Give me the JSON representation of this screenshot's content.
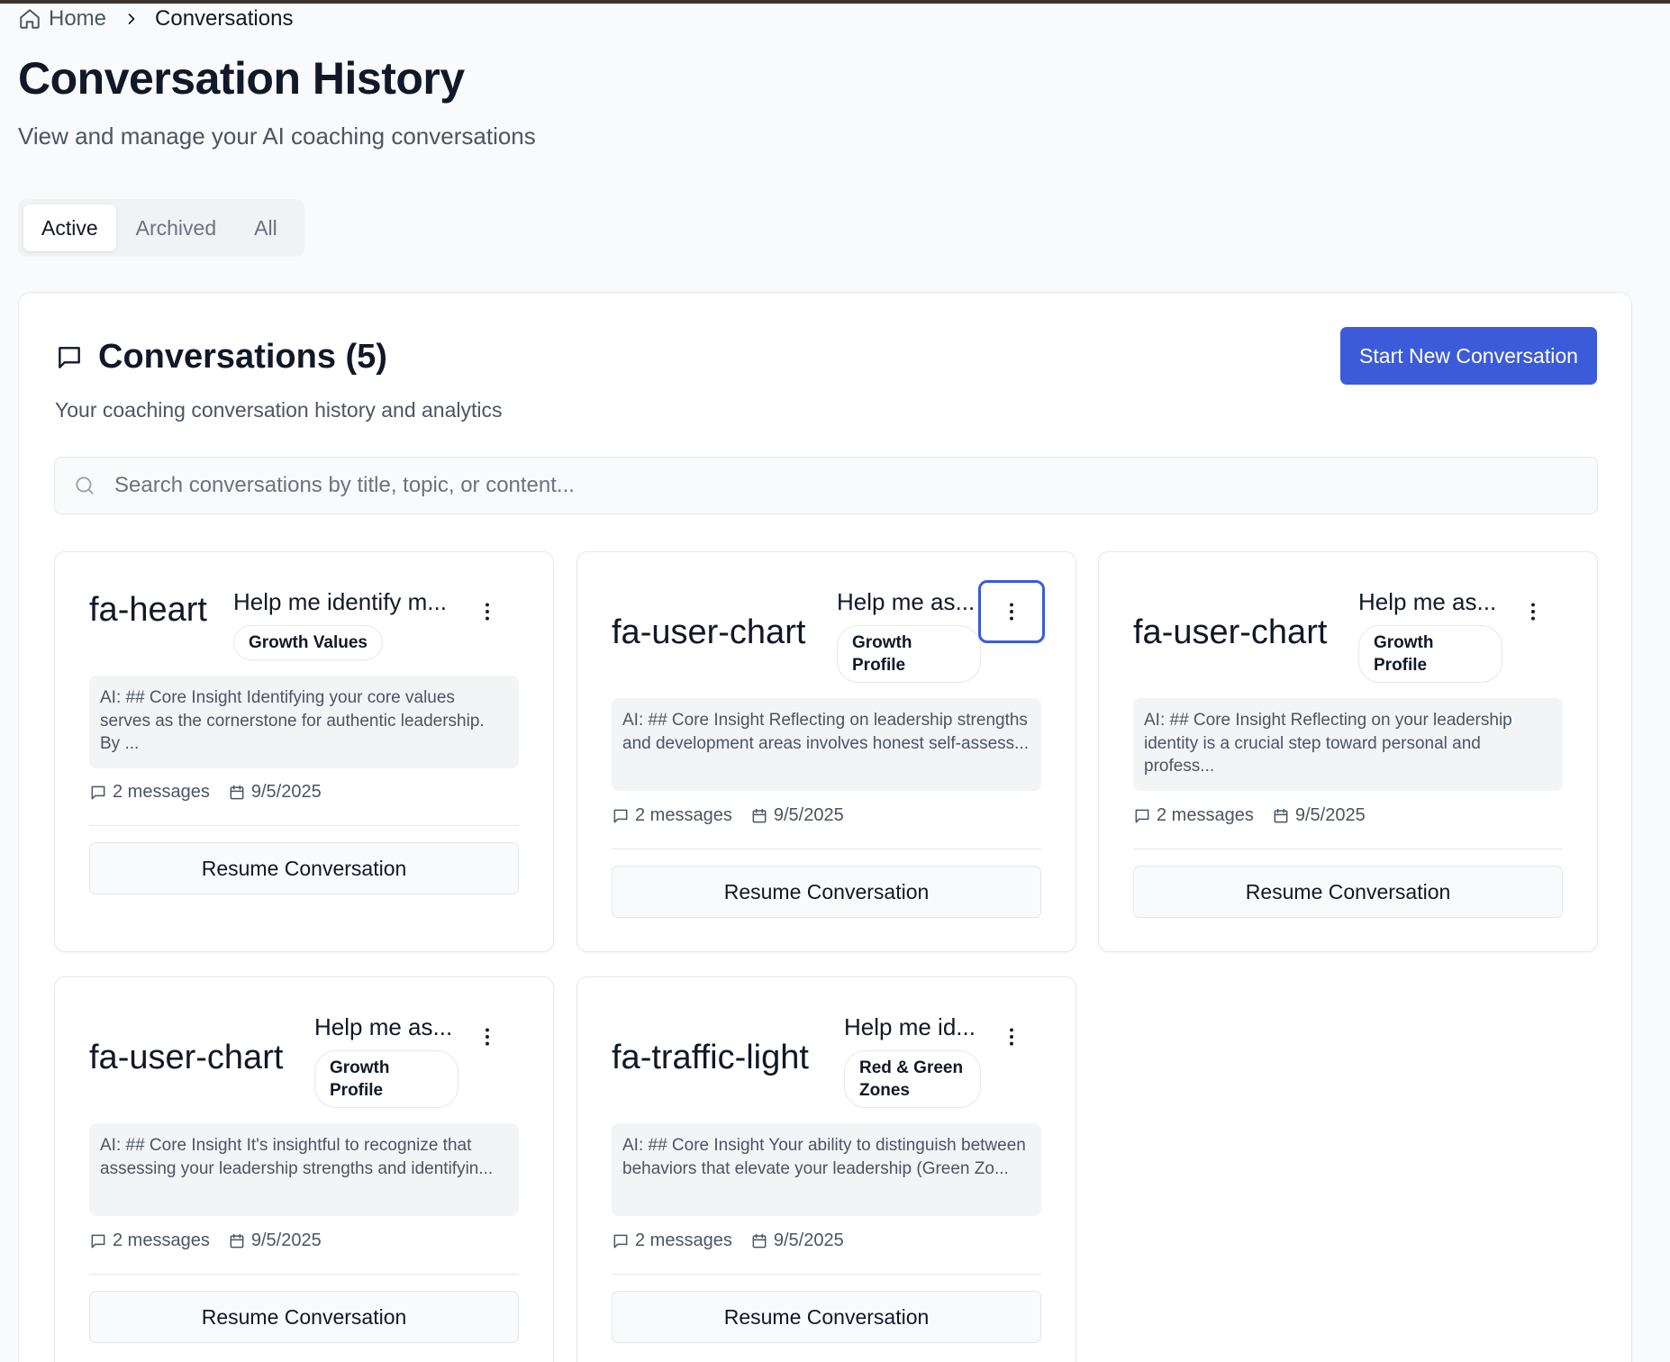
{
  "breadcrumb": {
    "home": "Home",
    "current": "Conversations"
  },
  "page": {
    "title": "Conversation History",
    "subtitle": "View and manage your AI coaching conversations"
  },
  "tabs": [
    {
      "label": "Active"
    },
    {
      "label": "Archived"
    },
    {
      "label": "All"
    }
  ],
  "panel": {
    "title": "Conversations (5)",
    "subtitle": "Your coaching conversation history and analytics",
    "new_button": "Start New Conversation"
  },
  "search": {
    "placeholder": "Search conversations by title, topic, or content..."
  },
  "colors": {
    "accent": "#3b5bdb",
    "text": "#111827",
    "muted": "#6b7280"
  },
  "conversations": [
    {
      "icon": "fa-heart",
      "title": "Help me identify m...",
      "badge": "Growth Values",
      "preview": "AI: ## Core Insight Identifying your core values serves as the cornerstone for authentic leadership. By ...",
      "messages": "2 messages",
      "date": "9/5/2025",
      "action": "Resume Conversation"
    },
    {
      "icon": "fa-user-chart",
      "title": "Help me as...",
      "badge": "Growth Profile",
      "preview": "AI: ## Core Insight Reflecting on leadership strengths and development areas involves honest self-assess...",
      "messages": "2 messages",
      "date": "9/5/2025",
      "action": "Resume Conversation"
    },
    {
      "icon": "fa-user-chart",
      "title": "Help me as...",
      "badge": "Growth Profile",
      "preview": "AI: ## Core Insight Reflecting on your leadership identity is a crucial step toward personal and profess...",
      "messages": "2 messages",
      "date": "9/5/2025",
      "action": "Resume Conversation"
    },
    {
      "icon": "fa-user-chart",
      "title": "Help me as...",
      "badge": "Growth Profile",
      "preview": "AI: ## Core Insight It's insightful to recognize that assessing your leadership strengths and identifyin...",
      "messages": "2 messages",
      "date": "9/5/2025",
      "action": "Resume Conversation"
    },
    {
      "icon": "fa-traffic-light",
      "title": "Help me id...",
      "badge": "Red & Green Zones",
      "preview": "AI: ## Core Insight Your ability to distinguish between behaviors that elevate your leadership (Green Zo...",
      "messages": "2 messages",
      "date": "9/5/2025",
      "action": "Resume Conversation"
    }
  ]
}
